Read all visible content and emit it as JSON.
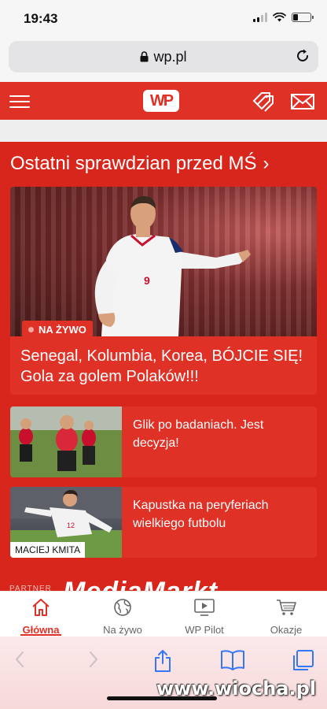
{
  "status_bar": {
    "time": "19:43"
  },
  "browser": {
    "url": "wp.pl"
  },
  "header": {
    "logo_text": "WP",
    "brand_color": "#e03127",
    "icons": [
      "menu-icon",
      "price-tag-icon",
      "mail-icon"
    ]
  },
  "section": {
    "title": "Ostatni sprawdzian przed MŚ",
    "chevron": "›"
  },
  "hero": {
    "badge": "NA ŻYWO",
    "title": "Senegal, Kolumbia, Korea, BÓJCIE SIĘ! Gola za golem Polaków!!!"
  },
  "articles": [
    {
      "title": "Glik po badaniach. Jest decyzja!",
      "credit": ""
    },
    {
      "title": "Kapustka na peryferiach wielkiego futbolu",
      "credit": "MACIEJ KMITA"
    }
  ],
  "partner": {
    "label": "PARTNER",
    "art_text": "MediaMarkt"
  },
  "bottom_nav": [
    {
      "label": "Główna",
      "icon": "home-icon",
      "active": true
    },
    {
      "label": "Na żywo",
      "icon": "globe-icon",
      "active": false
    },
    {
      "label": "WP Pilot",
      "icon": "tv-play-icon",
      "active": false
    },
    {
      "label": "Okazje",
      "icon": "cart-icon",
      "active": false
    }
  ],
  "watermark": "www.wiocha.pl"
}
